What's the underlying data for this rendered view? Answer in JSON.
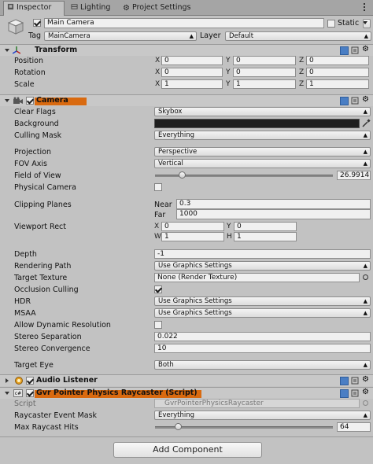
{
  "tabs": [
    {
      "label": "Inspector",
      "icon": "inspector-icon"
    },
    {
      "label": "Lighting",
      "icon": "lighting-icon"
    },
    {
      "label": "Project Settings",
      "icon": "gear-icon"
    }
  ],
  "header": {
    "name": "Main Camera",
    "active": true,
    "static_label": "Static",
    "tag_label": "Tag",
    "tag_value": "MainCamera",
    "layer_label": "Layer",
    "layer_value": "Default"
  },
  "transform": {
    "title": "Transform",
    "rows": [
      {
        "label": "Position",
        "x": "0",
        "y": "0",
        "z": "0"
      },
      {
        "label": "Rotation",
        "x": "0",
        "y": "0",
        "z": "0"
      },
      {
        "label": "Scale",
        "x": "1",
        "y": "1",
        "z": "1"
      }
    ],
    "axes": {
      "x": "X",
      "y": "Y",
      "z": "Z"
    }
  },
  "camera": {
    "title": "Camera",
    "clear_flags_label": "Clear Flags",
    "clear_flags_value": "Skybox",
    "background_label": "Background",
    "background_color": "#1e1e1e",
    "culling_mask_label": "Culling Mask",
    "culling_mask_value": "Everything",
    "projection_label": "Projection",
    "projection_value": "Perspective",
    "fov_axis_label": "FOV Axis",
    "fov_axis_value": "Vertical",
    "fov_label": "Field of View",
    "fov_value": "26.9914",
    "fov_fraction": 0.15,
    "physical_camera_label": "Physical Camera",
    "clipping_label": "Clipping Planes",
    "near_label": "Near",
    "near_value": "0.3",
    "far_label": "Far",
    "far_value": "1000",
    "viewport_label": "Viewport Rect",
    "vp_x": "0",
    "vp_y": "0",
    "vp_w": "1",
    "vp_h": "1",
    "vp_w_label": "W",
    "vp_h_label": "H",
    "depth_label": "Depth",
    "depth_value": "-1",
    "rendering_path_label": "Rendering Path",
    "rendering_path_value": "Use Graphics Settings",
    "target_texture_label": "Target Texture",
    "target_texture_value": "None (Render Texture)",
    "occlusion_label": "Occlusion Culling",
    "hdr_label": "HDR",
    "hdr_value": "Use Graphics Settings",
    "msaa_label": "MSAA",
    "msaa_value": "Use Graphics Settings",
    "dyn_res_label": "Allow Dynamic Resolution",
    "stereo_sep_label": "Stereo Separation",
    "stereo_sep_value": "0.022",
    "stereo_conv_label": "Stereo Convergence",
    "stereo_conv_value": "10",
    "target_eye_label": "Target Eye",
    "target_eye_value": "Both"
  },
  "audio_listener": {
    "title": "Audio Listener"
  },
  "raycaster": {
    "title": "Gvr Pointer Physics Raycaster (Script)",
    "script_label": "Script",
    "script_value": "GvrPointerPhysicsRaycaster",
    "event_mask_label": "Raycaster Event Mask",
    "event_mask_value": "Everything",
    "max_hits_label": "Max Raycast Hits",
    "max_hits_value": "64",
    "max_hits_fraction": 0.13
  },
  "add_component_label": "Add Component",
  "colors": {
    "highlight": "#d96a10",
    "panel": "#c2c2c2"
  }
}
